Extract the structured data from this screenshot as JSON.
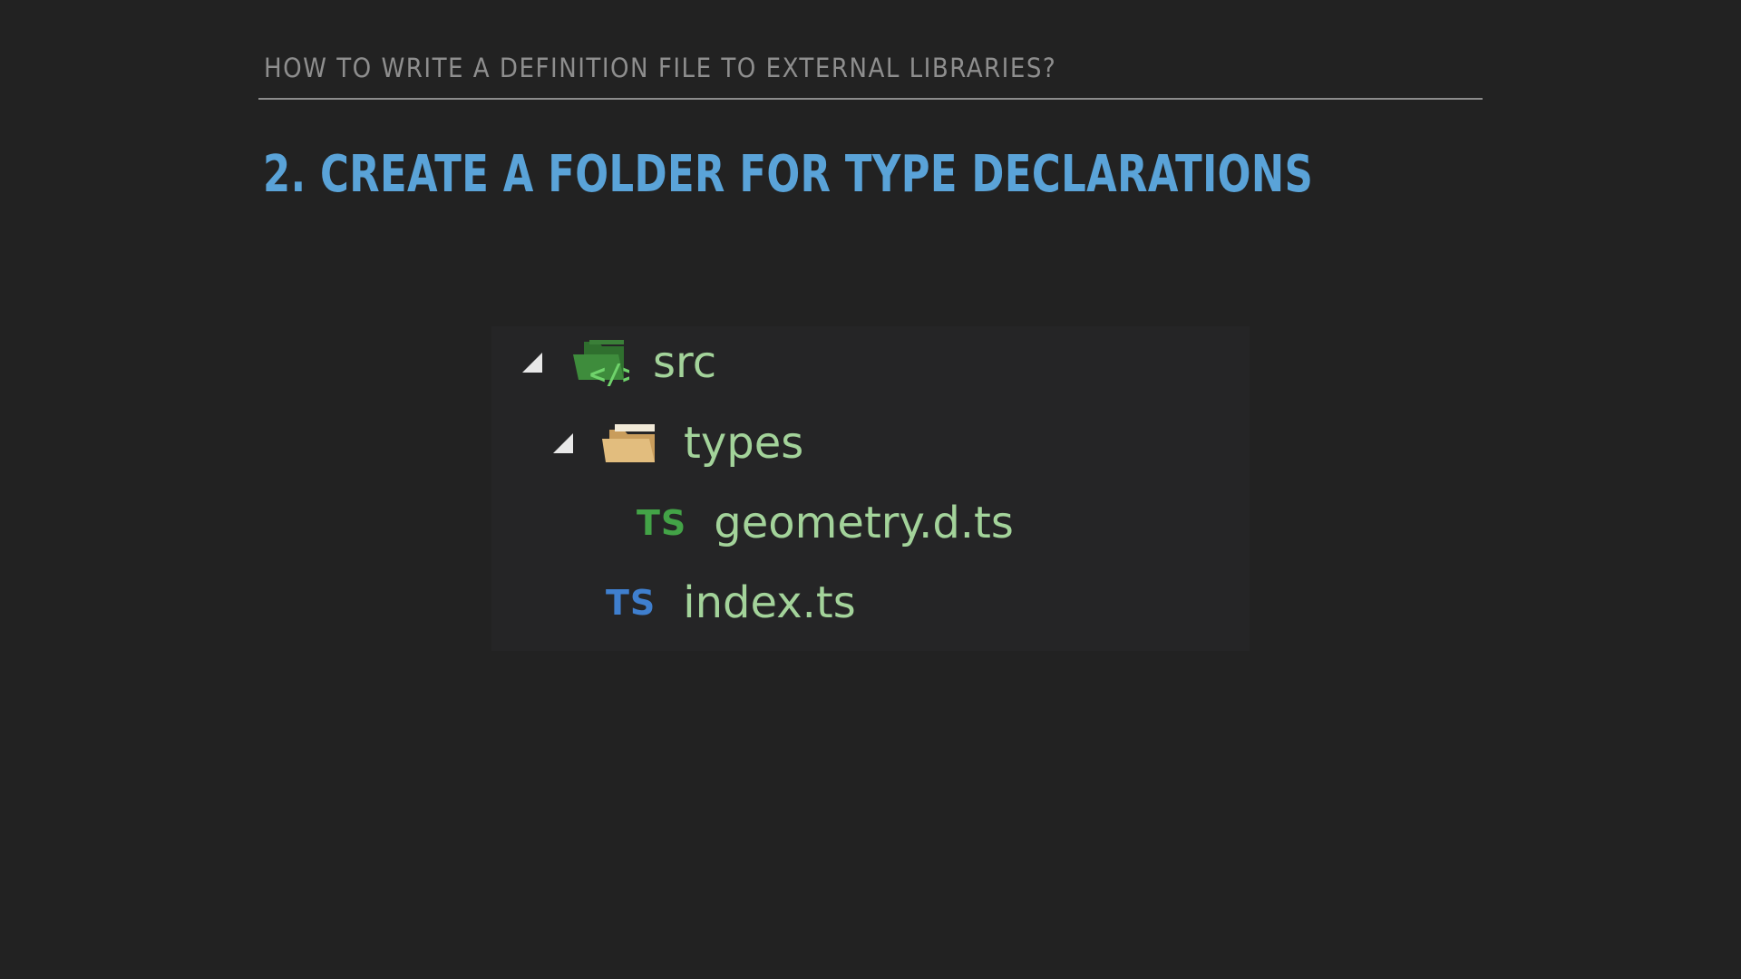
{
  "slide": {
    "section_header": "HOW TO WRITE A DEFINITION FILE TO EXTERNAL LIBRARIES?",
    "title": "2. CREATE A FOLDER FOR TYPE DECLARATIONS"
  },
  "explorer": {
    "items": [
      {
        "label": "src",
        "icon": "code-folder-icon",
        "expanded": true,
        "depth": 0
      },
      {
        "label": "types",
        "icon": "folder-open-icon",
        "expanded": true,
        "depth": 1
      },
      {
        "label": "geometry.d.ts",
        "icon": "typescript-definition-icon",
        "icon_text": "TS",
        "depth": 2
      },
      {
        "label": "index.ts",
        "icon": "typescript-file-icon",
        "icon_text": "TS",
        "depth": 1
      }
    ]
  },
  "colors": {
    "background": "#222222",
    "title": "#5aa3d8",
    "header_text": "#8e8e8e",
    "tree_label": "#a3d39a",
    "ts_definition": "#43a347",
    "ts_file": "#3f7fce",
    "folder_src": "#3e8c3c",
    "folder_types": "#e2bd7e"
  }
}
